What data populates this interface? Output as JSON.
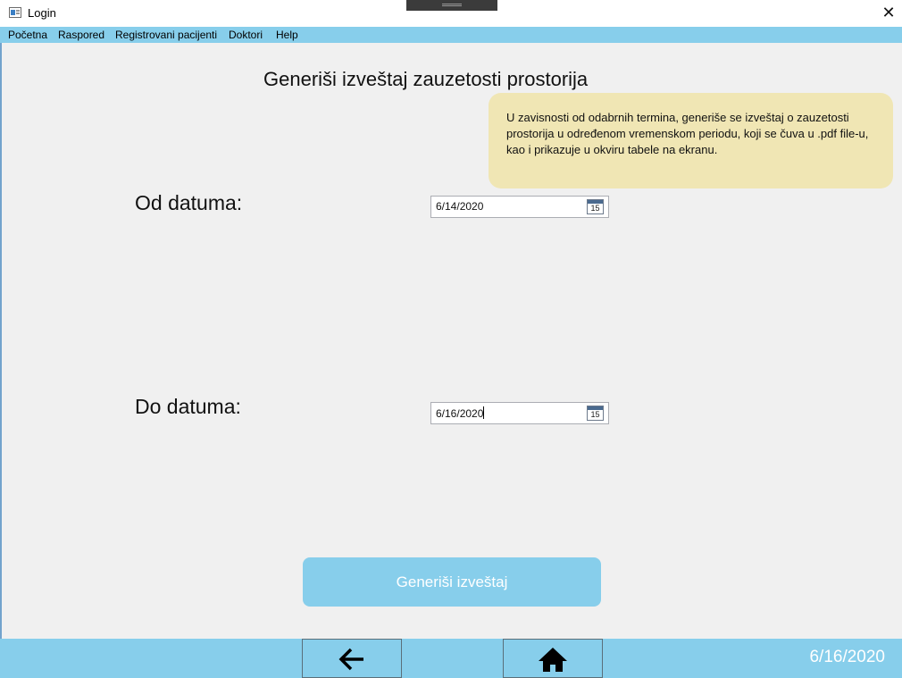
{
  "window": {
    "title": "Login",
    "close_glyph": "✕"
  },
  "menu": {
    "items": [
      "Početna",
      "Raspored",
      "Registrovani pacijenti",
      "Doktori",
      "Help"
    ]
  },
  "page": {
    "title": "Generiši izveštaj zauzetosti prostorija",
    "tooltip": "U zavisnosti od odabrnih termina, generiše se izveštaj o zauzetosti prostorija u određenom vremenskom periodu, koji se čuva u .pdf file-u, kao i prikazuje u okviru tabele na ekranu."
  },
  "form": {
    "from_label": "Od datuma:",
    "from_value": "6/14/2020",
    "to_label": "Do datuma:",
    "to_value": "6/16/2020",
    "calendar_day": "15",
    "generate_label": "Generiši izveštaj"
  },
  "footer": {
    "date": "6/16/2020",
    "back_icon": "arrow-left-icon",
    "home_icon": "home-icon"
  },
  "colors": {
    "accent": "#87ceeb",
    "tooltip_bg": "#f0e6b4",
    "background": "#f0f0f0"
  }
}
